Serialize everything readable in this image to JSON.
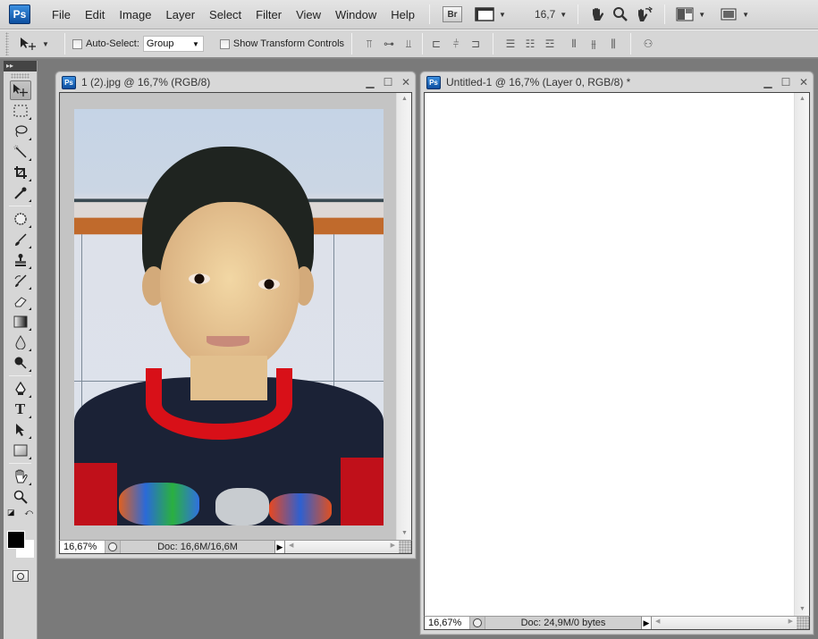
{
  "app": {
    "logo": "Ps",
    "menu": [
      "File",
      "Edit",
      "Image",
      "Layer",
      "Select",
      "Filter",
      "View",
      "Window",
      "Help"
    ],
    "toolbar": {
      "bridge_label": "Br",
      "zoom_value": "16,7",
      "icons": [
        "mini-bridge",
        "screen-layout",
        "hand-tool",
        "zoom-tool",
        "rotate-view",
        "arrange-documents",
        "screen-mode"
      ]
    }
  },
  "options_bar": {
    "auto_select_label": "Auto-Select:",
    "auto_select_checked": false,
    "auto_select_value": "Group",
    "show_transform_label": "Show Transform Controls",
    "show_transform_checked": false,
    "align_icons": [
      "align-top",
      "align-vcenter",
      "align-bottom",
      "align-left",
      "align-hcenter",
      "align-right",
      "distribute-top",
      "distribute-vcenter",
      "distribute-bottom",
      "distribute-left",
      "distribute-hcenter",
      "distribute-right",
      "auto-align"
    ]
  },
  "tools_panel": {
    "collapse_label": "▸▸",
    "tools": [
      "move",
      "marquee",
      "lasso",
      "magic-wand",
      "crop",
      "eyedropper",
      "spot-healing",
      "brush",
      "clone-stamp",
      "history-brush",
      "eraser",
      "gradient",
      "blur",
      "dodge",
      "pen",
      "type",
      "path-selection",
      "rectangle",
      "hand",
      "zoom"
    ],
    "foreground_color": "#000000",
    "background_color": "#ffffff"
  },
  "documents": [
    {
      "title": "1 (2).jpg @ 16,7% (RGB/8)",
      "zoom": "16,67%",
      "doc_info": "Doc: 16,6M/16,6M"
    },
    {
      "title": "Untitled-1 @ 16,7% (Layer 0, RGB/8) *",
      "zoom": "16,67%",
      "doc_info": "Doc: 24,9M/0 bytes"
    }
  ]
}
